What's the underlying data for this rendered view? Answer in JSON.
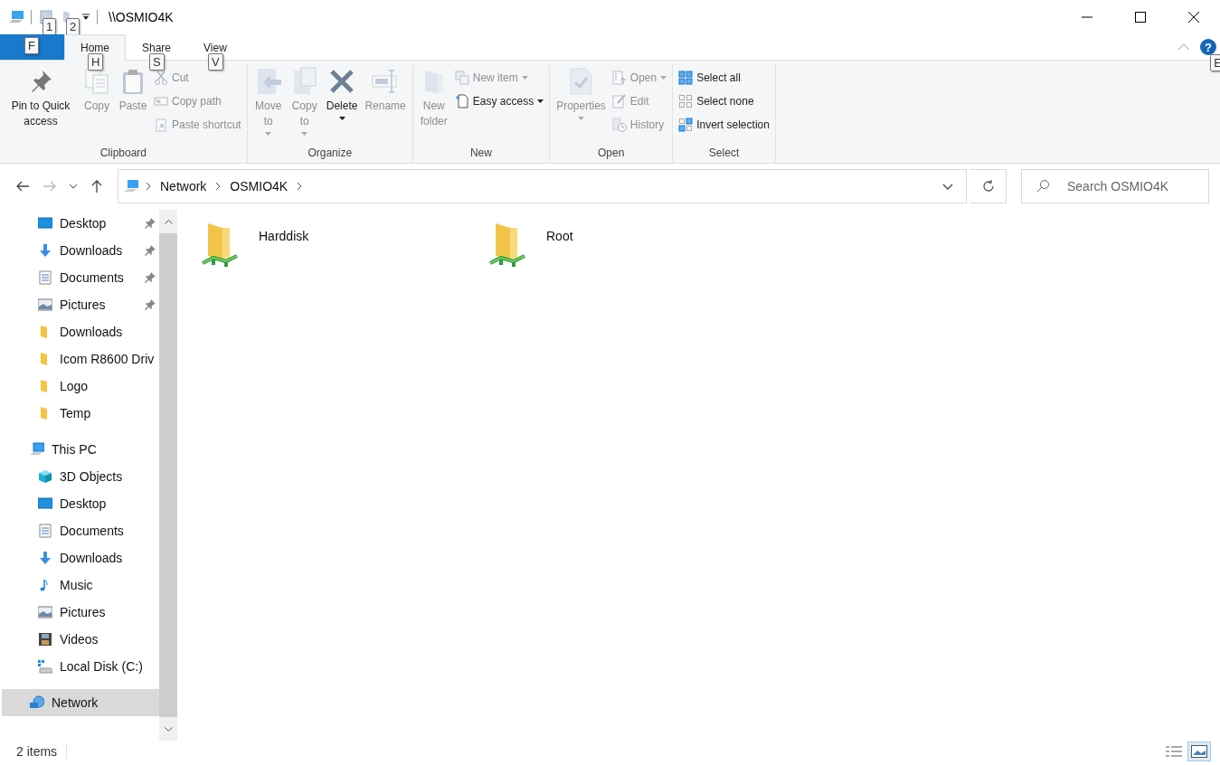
{
  "window": {
    "title": "\\\\OSMIO4K",
    "quick_access_keytips": [
      "1",
      "2"
    ]
  },
  "ribbon_tabs": [
    {
      "label": "Home",
      "keytip": "H",
      "selected": true
    },
    {
      "label": "Share",
      "keytip": "S",
      "selected": false
    },
    {
      "label": "View",
      "keytip": "V",
      "selected": false
    }
  ],
  "file_keytip": "F",
  "help_button": "?",
  "help_keytip": "E",
  "ribbon_groups": [
    {
      "label": "Clipboard",
      "columns": [
        {
          "kind": "large",
          "items": [
            {
              "kind": "pin",
              "label": "Pin to Quick access",
              "disabled": false,
              "dropdown": false
            }
          ]
        },
        {
          "kind": "large",
          "items": [
            {
              "kind": "copy",
              "label": "Copy",
              "disabled": true,
              "dropdown": false
            }
          ]
        },
        {
          "kind": "large",
          "items": [
            {
              "kind": "paste",
              "label": "Paste",
              "disabled": true,
              "dropdown": false
            }
          ]
        },
        {
          "kind": "stack",
          "items": [
            {
              "kind": "cut",
              "label": "Cut",
              "disabled": true,
              "dropdown": false
            },
            {
              "kind": "copypath",
              "label": "Copy path",
              "disabled": true,
              "dropdown": false
            },
            {
              "kind": "pasteshortcut",
              "label": "Paste shortcut",
              "disabled": true,
              "dropdown": false
            }
          ]
        }
      ]
    },
    {
      "label": "Organize",
      "columns": [
        {
          "kind": "large",
          "items": [
            {
              "kind": "move",
              "label": "Move to",
              "disabled": true,
              "dropdown": true
            }
          ]
        },
        {
          "kind": "large",
          "items": [
            {
              "kind": "copyto",
              "label": "Copy to",
              "disabled": true,
              "dropdown": true
            }
          ]
        },
        {
          "kind": "large",
          "items": [
            {
              "kind": "delete",
              "label": "Delete",
              "disabled": false,
              "dropdown": true
            }
          ]
        },
        {
          "kind": "large",
          "items": [
            {
              "kind": "rename",
              "label": "Rename",
              "disabled": true,
              "dropdown": false
            }
          ]
        }
      ]
    },
    {
      "label": "New",
      "columns": [
        {
          "kind": "large",
          "items": [
            {
              "kind": "newfolder",
              "label": "New folder",
              "disabled": true,
              "dropdown": false
            }
          ]
        },
        {
          "kind": "stack",
          "items": [
            {
              "kind": "newitem",
              "label": "New item",
              "disabled": true,
              "dropdown": true
            },
            {
              "kind": "easyaccess",
              "label": "Easy access",
              "disabled": false,
              "dropdown": true
            }
          ]
        }
      ]
    },
    {
      "label": "Open",
      "columns": [
        {
          "kind": "large",
          "items": [
            {
              "kind": "properties",
              "label": "Properties",
              "disabled": true,
              "dropdown": true
            }
          ]
        },
        {
          "kind": "stack",
          "items": [
            {
              "kind": "open",
              "label": "Open",
              "disabled": true,
              "dropdown": true
            },
            {
              "kind": "edit",
              "label": "Edit",
              "disabled": true,
              "dropdown": false
            },
            {
              "kind": "history",
              "label": "History",
              "disabled": true,
              "dropdown": false
            }
          ]
        }
      ]
    },
    {
      "label": "Select",
      "columns": [
        {
          "kind": "stack",
          "items": [
            {
              "kind": "selectall",
              "label": "Select all",
              "disabled": false,
              "dropdown": false
            },
            {
              "kind": "selectnone",
              "label": "Select none",
              "disabled": false,
              "dropdown": false
            },
            {
              "kind": "invert",
              "label": "Invert selection",
              "disabled": false,
              "dropdown": false
            }
          ]
        }
      ]
    }
  ],
  "navigation": {
    "back_disabled": false,
    "forward_disabled": true
  },
  "breadcrumb": [
    "Network",
    "OSMIO4K"
  ],
  "search": {
    "placeholder": "Search OSMIO4K"
  },
  "sidebar": {
    "quick_access": [
      {
        "kind": "desktop",
        "label": "Desktop",
        "pinned": true,
        "selected": false
      },
      {
        "kind": "downloads",
        "label": "Downloads",
        "pinned": true,
        "selected": false
      },
      {
        "kind": "documents",
        "label": "Documents",
        "pinned": true,
        "selected": false
      },
      {
        "kind": "pictures",
        "label": "Pictures",
        "pinned": true,
        "selected": false
      },
      {
        "kind": "folder",
        "label": "Downloads",
        "pinned": false,
        "selected": false
      },
      {
        "kind": "folder",
        "label": "Icom R8600 Driv",
        "pinned": false,
        "selected": false
      },
      {
        "kind": "folder",
        "label": "Logo",
        "pinned": false,
        "selected": false
      },
      {
        "kind": "folder",
        "label": "Temp",
        "pinned": false,
        "selected": false
      }
    ],
    "tree": [
      {
        "kind": "pc",
        "label": "This PC",
        "selected": false,
        "children": [
          {
            "kind": "cube",
            "label": "3D Objects",
            "selected": false
          },
          {
            "kind": "desktop",
            "label": "Desktop",
            "selected": false
          },
          {
            "kind": "documents",
            "label": "Documents",
            "selected": false
          },
          {
            "kind": "downloads",
            "label": "Downloads",
            "selected": false
          },
          {
            "kind": "music",
            "label": "Music",
            "selected": false
          },
          {
            "kind": "pictures",
            "label": "Pictures",
            "selected": false
          },
          {
            "kind": "videos",
            "label": "Videos",
            "selected": false
          },
          {
            "kind": "disk",
            "label": "Local Disk (C:)",
            "selected": false
          }
        ]
      },
      {
        "kind": "network",
        "label": "Network",
        "selected": true
      }
    ]
  },
  "items": [
    {
      "label": "Harddisk"
    },
    {
      "label": "Root"
    }
  ],
  "status_bar": {
    "count": "2 items",
    "views": [
      {
        "kind": "details",
        "selected": false
      },
      {
        "kind": "large_icons",
        "selected": true
      }
    ]
  }
}
